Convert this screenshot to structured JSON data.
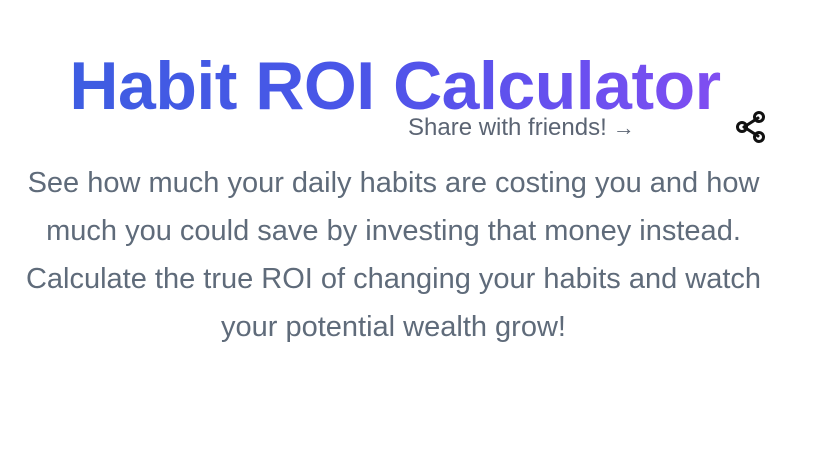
{
  "header": {
    "title": "Habit ROI Calculator",
    "gradient_colors": [
      "#3b5fe0",
      "#8b4ef2"
    ]
  },
  "share": {
    "label": "Share with friends!",
    "arrow": "→",
    "icon": "share-icon"
  },
  "intro": {
    "description": "See how much your daily habits are costing you and how much you could save by investing that money instead. Calculate the true ROI of changing your habits and watch your potential wealth grow!"
  },
  "colors": {
    "text_muted": "#5f6b7a",
    "icon": "#111111"
  }
}
